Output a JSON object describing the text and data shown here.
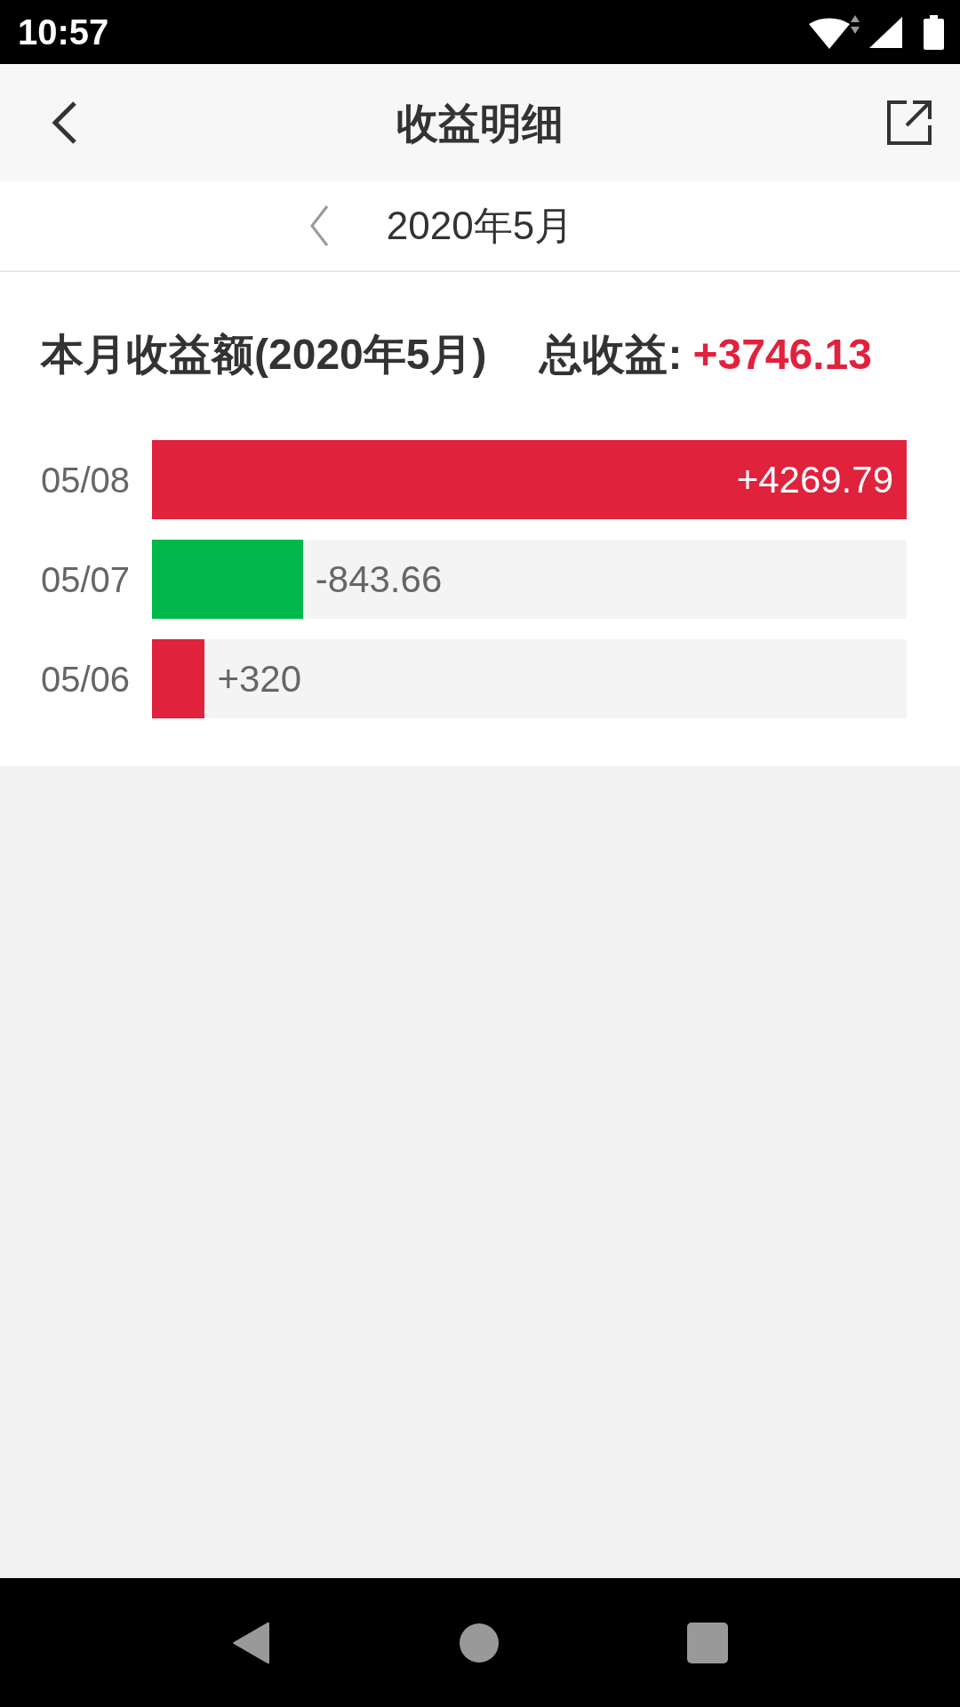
{
  "status_bar": {
    "time": "10:57"
  },
  "header": {
    "title": "收益明细"
  },
  "month_picker": {
    "month": "2020年5月"
  },
  "summary": {
    "title": "本月收益额(2020年5月)",
    "total_label": "总收益:",
    "total_value": "+3746.13"
  },
  "rows": [
    {
      "date": "05/08",
      "amount": "+4269.79",
      "level": 1,
      "color": "#e0223c"
    },
    {
      "date": "05/07",
      "amount": "-843.66",
      "level": 0.2,
      "color": "#00b84c"
    },
    {
      "date": "05/06",
      "amount": "+320",
      "level": 0.07,
      "color": "#e0223c"
    }
  ]
}
